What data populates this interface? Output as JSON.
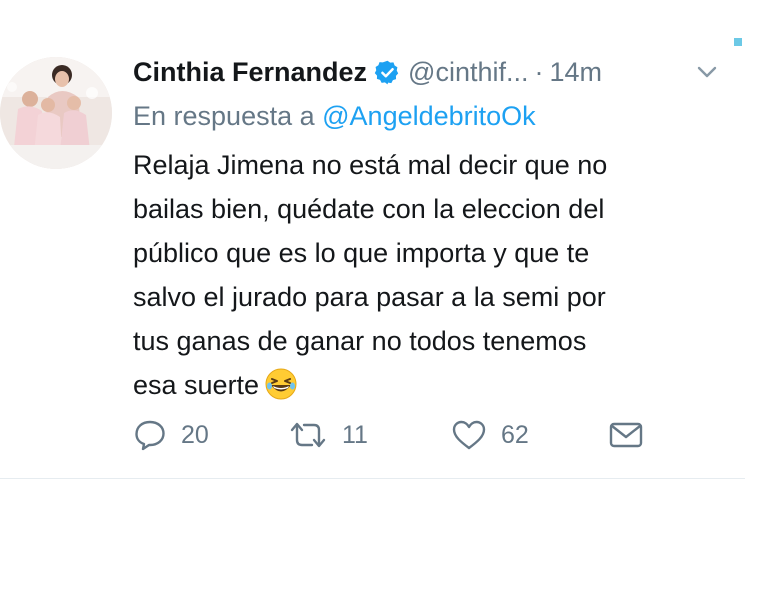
{
  "tweet": {
    "author_name": "Cinthia Fernandez",
    "handle": "@cinthif...",
    "separator": "·",
    "time": "14m",
    "reply_prefix": "En respuesta a",
    "reply_mention": "@AngeldebritoOk",
    "text_lines": [
      "Relaja Jimena no está mal decir que no",
      "bailas bien, quédate con la eleccion del",
      "público que es lo que importa y que te",
      "salvo el jurado para pasar a la semi por",
      "tus ganas de ganar no todos tenemos",
      "esa suerte"
    ],
    "emoji": "grinning-squinting-face",
    "verified": true
  },
  "actions": {
    "replies": "20",
    "retweets": "11",
    "likes": "62"
  },
  "icons": [
    "verified-badge-icon",
    "chevron-down-icon",
    "reply-icon",
    "retweet-icon",
    "like-icon",
    "message-icon"
  ],
  "colors": {
    "text_primary": "#14171a",
    "text_secondary": "#657786",
    "link": "#1da1f2",
    "verified": "#1da1f2"
  }
}
